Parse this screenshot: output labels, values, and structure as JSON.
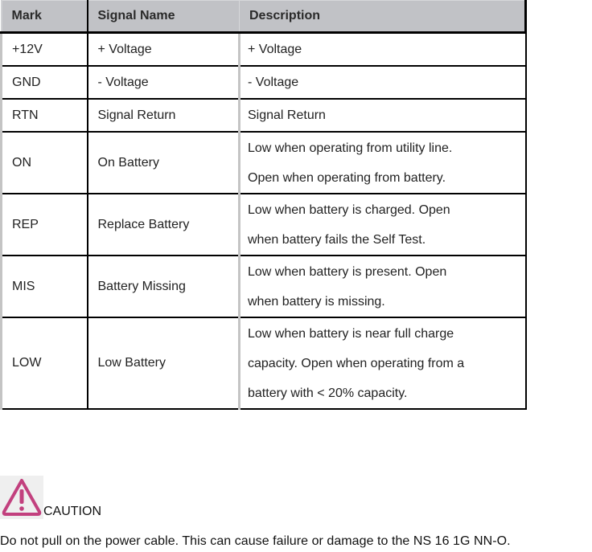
{
  "table": {
    "headers": [
      "Mark",
      "Signal Name",
      "Description"
    ],
    "rows": [
      {
        "mark": "+12V",
        "name": "+ Voltage",
        "desc": [
          "+ Voltage"
        ]
      },
      {
        "mark": "GND",
        "name": "- Voltage",
        "desc": [
          "- Voltage"
        ]
      },
      {
        "mark": "RTN",
        "name": "Signal Return",
        "desc": [
          "Signal Return"
        ]
      },
      {
        "mark": "ON",
        "name": "On Battery",
        "desc": [
          "Low when operating from utility line.",
          "Open when operating from battery."
        ]
      },
      {
        "mark": "REP",
        "name": "Replace Battery",
        "desc": [
          "Low when battery is charged. Open",
          "when battery fails the Self Test."
        ]
      },
      {
        "mark": "MIS",
        "name": "Battery Missing",
        "desc": [
          "Low when battery is present. Open",
          "when battery is missing."
        ]
      },
      {
        "mark": "LOW",
        "name": "Low Battery",
        "desc": [
          "Low when battery is near full charge",
          "capacity. Open when operating from a",
          "battery with < 20% capacity."
        ]
      }
    ]
  },
  "caution": {
    "icon": "warning-triangle-icon",
    "icon_color": "#c2407e",
    "label": "CAUTION",
    "text": "Do not pull on the power cable. This can cause failure or damage to the NS 16 1G NN-O."
  }
}
